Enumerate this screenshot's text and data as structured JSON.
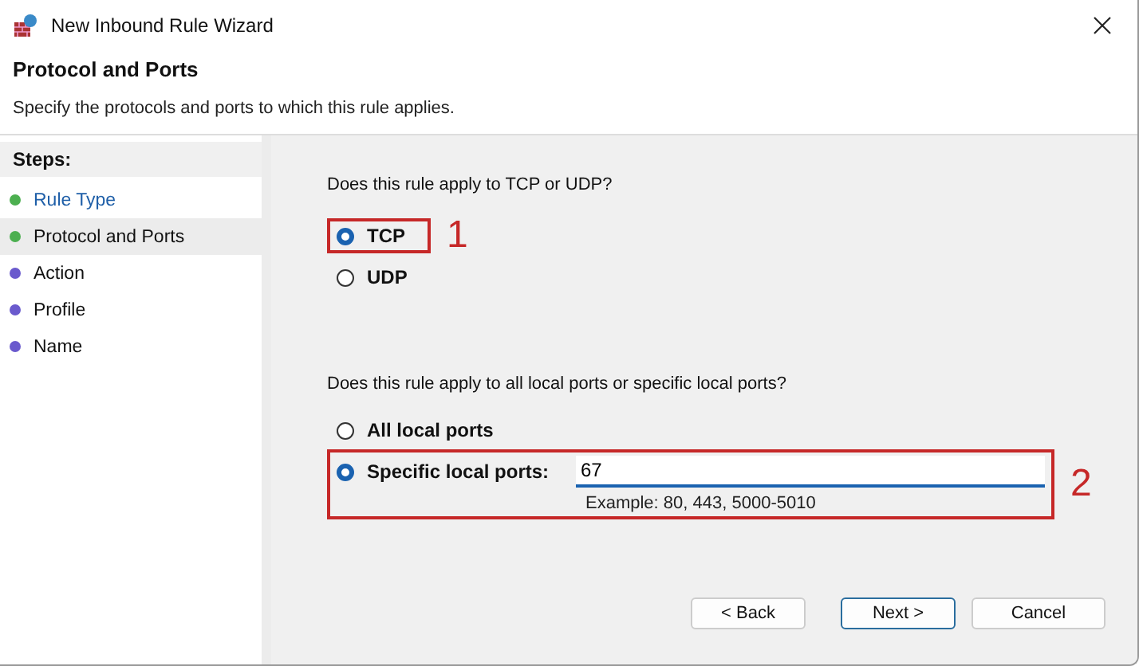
{
  "window": {
    "title": "New Inbound Rule Wizard"
  },
  "header": {
    "title": "Protocol and Ports",
    "subtitle": "Specify the protocols and ports to which this rule applies."
  },
  "steps": {
    "heading": "Steps:",
    "items": [
      {
        "label": "Rule Type",
        "selected": false,
        "link": true,
        "color": "#4caf50"
      },
      {
        "label": "Protocol and Ports",
        "selected": true,
        "link": false,
        "color": "#4caf50"
      },
      {
        "label": "Action",
        "selected": false,
        "link": false,
        "color": "#6a5acd"
      },
      {
        "label": "Profile",
        "selected": false,
        "link": false,
        "color": "#6a5acd"
      },
      {
        "label": "Name",
        "selected": false,
        "link": false,
        "color": "#6a5acd"
      }
    ]
  },
  "protocol": {
    "question": "Does this rule apply to TCP or UDP?",
    "options": [
      {
        "label": "TCP",
        "selected": true,
        "annotation": "1"
      },
      {
        "label": "UDP",
        "selected": false
      }
    ]
  },
  "ports": {
    "question": "Does this rule apply to all local ports or specific local ports?",
    "options": [
      {
        "label": "All local ports",
        "selected": false
      },
      {
        "label": "Specific local ports:",
        "selected": true,
        "annotation": "2",
        "value": "67",
        "hint": "Example: 80, 443, 5000-5010"
      }
    ]
  },
  "buttons": [
    {
      "label": "< Back",
      "default": false
    },
    {
      "label": "Next >",
      "default": true
    },
    {
      "label": "Cancel",
      "default": false
    }
  ]
}
